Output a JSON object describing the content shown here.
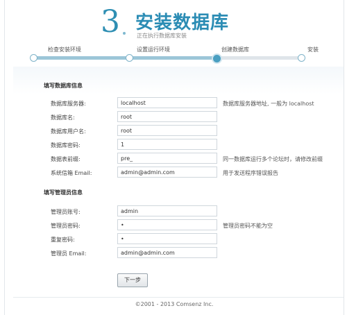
{
  "header": {
    "step_number": "3",
    "title": "安装数据库",
    "subtitle": "正在执行数据库安装"
  },
  "progress": {
    "current_index": 2,
    "steps": [
      {
        "label": "检查安装环境"
      },
      {
        "label": "设置运行环境"
      },
      {
        "label": "创建数据库"
      },
      {
        "label": "安装"
      }
    ]
  },
  "db_section": {
    "heading": "填写数据库信息",
    "fields": [
      {
        "label": "数据库服务器:",
        "value": "localhost",
        "hint": "数据库服务器地址, 一般为 localhost"
      },
      {
        "label": "数据库名:",
        "value": "root",
        "hint": ""
      },
      {
        "label": "数据库用户名:",
        "value": "root",
        "hint": ""
      },
      {
        "label": "数据库密码:",
        "value": "1",
        "hint": ""
      },
      {
        "label": "数据表前缀:",
        "value": "pre_",
        "hint": "同一数据库运行多个论坛时，请修改前缀"
      },
      {
        "label": "系统信箱 Email:",
        "value": "admin@admin.com",
        "hint": "用于发送程序错误报告"
      }
    ]
  },
  "admin_section": {
    "heading": "填写管理员信息",
    "fields": [
      {
        "label": "管理员账号:",
        "value": "admin",
        "hint": ""
      },
      {
        "label": "管理员密码:",
        "value": "•",
        "hint": "管理员密码不能为空"
      },
      {
        "label": "重复密码:",
        "value": "•",
        "hint": ""
      },
      {
        "label": "管理员 Email:",
        "value": "admin@admin.com",
        "hint": ""
      }
    ]
  },
  "actions": {
    "next_label": "下一步"
  },
  "footer": {
    "copyright": "©2001 - 2013 Comsenz Inc."
  }
}
